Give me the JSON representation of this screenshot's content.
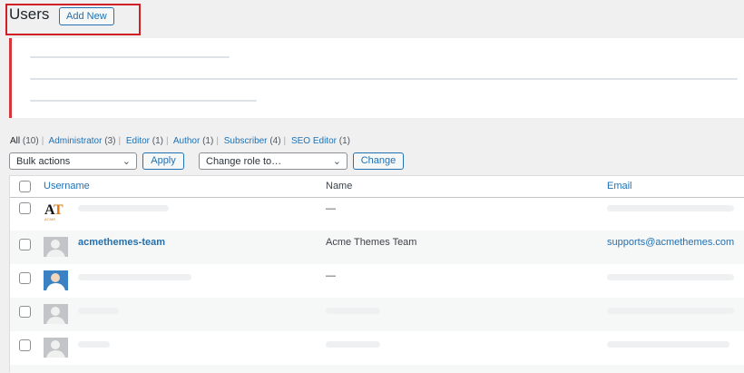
{
  "header": {
    "title": "Users",
    "add_new_label": "Add New"
  },
  "filters": [
    {
      "label": "All",
      "count": "(10)",
      "current": true
    },
    {
      "label": "Administrator",
      "count": "(3)",
      "current": false
    },
    {
      "label": "Editor",
      "count": "(1)",
      "current": false
    },
    {
      "label": "Author",
      "count": "(1)",
      "current": false
    },
    {
      "label": "Subscriber",
      "count": "(4)",
      "current": false
    },
    {
      "label": "SEO Editor",
      "count": "(1)",
      "current": false
    }
  ],
  "filter_separator": "|",
  "bulk_actions": {
    "selected": "Bulk actions",
    "apply_label": "Apply"
  },
  "change_role": {
    "selected": "Change role to…",
    "change_label": "Change"
  },
  "table": {
    "columns": {
      "username": "Username",
      "name": "Name",
      "email": "Email"
    },
    "rows": [
      {
        "username": "",
        "name": "—",
        "email": "",
        "avatar": "acme-logo"
      },
      {
        "username": "acmethemes-team",
        "name": "Acme Themes Team",
        "email": "supports@acmethemes.com",
        "avatar": "default"
      },
      {
        "username": "",
        "name": "—",
        "email": "",
        "avatar": "person-photo"
      },
      {
        "username": "",
        "name": "",
        "email": "",
        "avatar": "default"
      },
      {
        "username": "",
        "name": "",
        "email": "",
        "avatar": "default"
      }
    ]
  },
  "colors": {
    "link": "#2271b1",
    "highlight": "#d11f26",
    "notice_border": "#d63638",
    "background": "#f0f0f1"
  },
  "icons": {
    "dropdown": "chevron-down-icon",
    "checkbox": "checkbox-icon",
    "avatar": "user-avatar-icon"
  }
}
